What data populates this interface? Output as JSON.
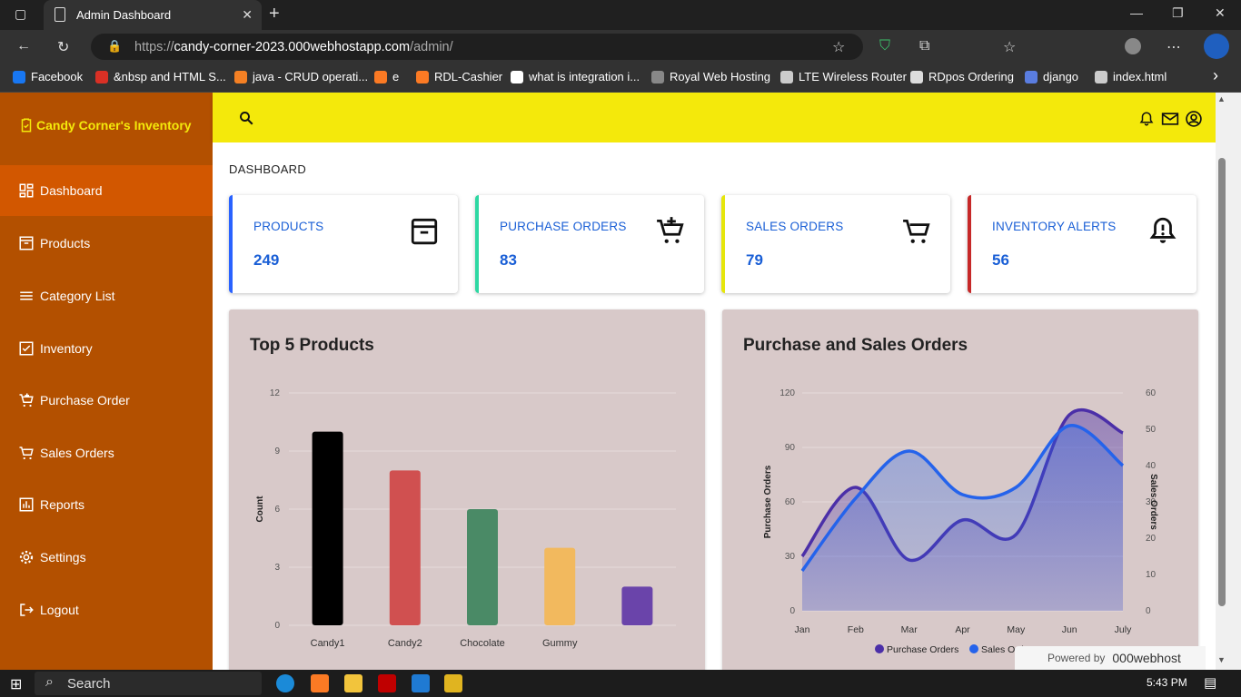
{
  "browser": {
    "tab_title": "Admin Dashboard",
    "url_prefix": "https://",
    "url_host": "candy-corner-2023.000webhostapp.com",
    "url_path": "/admin/",
    "bookmarks": [
      "Facebook",
      "&nbsp and HTML S...",
      "java - CRUD operati...",
      "e",
      "RDL-Cashier",
      "what is integration i...",
      "Royal Web Hosting",
      "LTE Wireless Router",
      "RDpos Ordering",
      "django",
      "index.html"
    ]
  },
  "sidebar": {
    "brand": "Candy Corner's Inventory",
    "items": [
      {
        "label": "Dashboard",
        "icon": "dashboard-icon"
      },
      {
        "label": "Products",
        "icon": "archive-icon"
      },
      {
        "label": "Category List",
        "icon": "list-icon"
      },
      {
        "label": "Inventory",
        "icon": "inventory-icon"
      },
      {
        "label": "Purchase Order",
        "icon": "cart-add-icon"
      },
      {
        "label": "Sales Orders",
        "icon": "cart-icon"
      },
      {
        "label": "Reports",
        "icon": "bar-chart-icon"
      },
      {
        "label": "Settings",
        "icon": "gear-icon"
      },
      {
        "label": "Logout",
        "icon": "logout-icon"
      }
    ]
  },
  "main": {
    "title": "DASHBOARD",
    "cards": [
      {
        "label": "PRODUCTS",
        "value": "249",
        "color": "#2962ff",
        "icon": "archive-icon"
      },
      {
        "label": "PURCHASE ORDERS",
        "value": "83",
        "color": "#2ed8a3",
        "icon": "cart-add-icon"
      },
      {
        "label": "SALES ORDERS",
        "value": "79",
        "color": "#e6e60a",
        "icon": "cart-icon"
      },
      {
        "label": "INVENTORY ALERTS",
        "value": "56",
        "color": "#c62828",
        "icon": "bell-alert-icon"
      }
    ]
  },
  "chart_data": [
    {
      "type": "bar",
      "title": "Top 5 Products",
      "ylabel": "Count",
      "categories": [
        "Candy1",
        "Candy2",
        "Chocolate",
        "Gummy",
        ""
      ],
      "values": [
        10,
        8,
        6,
        4,
        2
      ],
      "colors": [
        "#000000",
        "#d05050",
        "#4a8a66",
        "#f2b95e",
        "#6a44aa"
      ],
      "ylim": [
        0,
        12
      ],
      "yticks": [
        0,
        3,
        6,
        9,
        12
      ]
    },
    {
      "type": "area",
      "title": "Purchase and Sales Orders",
      "categories": [
        "Jan",
        "Feb",
        "Mar",
        "Apr",
        "May",
        "Jun",
        "July"
      ],
      "ylabel": "Purchase Orders",
      "y2label": "Sales Orders",
      "ylim": [
        0,
        120
      ],
      "y2lim": [
        0,
        60
      ],
      "yticks": [
        0,
        30,
        60,
        90,
        120
      ],
      "y2ticks": [
        0,
        10,
        20,
        30,
        40,
        50,
        60
      ],
      "series": [
        {
          "name": "Purchase Orders",
          "axis": "left",
          "values": [
            30,
            68,
            28,
            50,
            42,
            108,
            98
          ],
          "color": "#4b2fa8"
        },
        {
          "name": "Sales Orders",
          "axis": "right",
          "values": [
            11,
            31,
            44,
            32,
            34,
            51,
            40
          ],
          "color": "#2563eb"
        }
      ]
    }
  ],
  "powered": {
    "prefix": "Powered by",
    "brand": "000webhost"
  },
  "taskbar": {
    "search": "Search",
    "time": "5:43 PM"
  }
}
